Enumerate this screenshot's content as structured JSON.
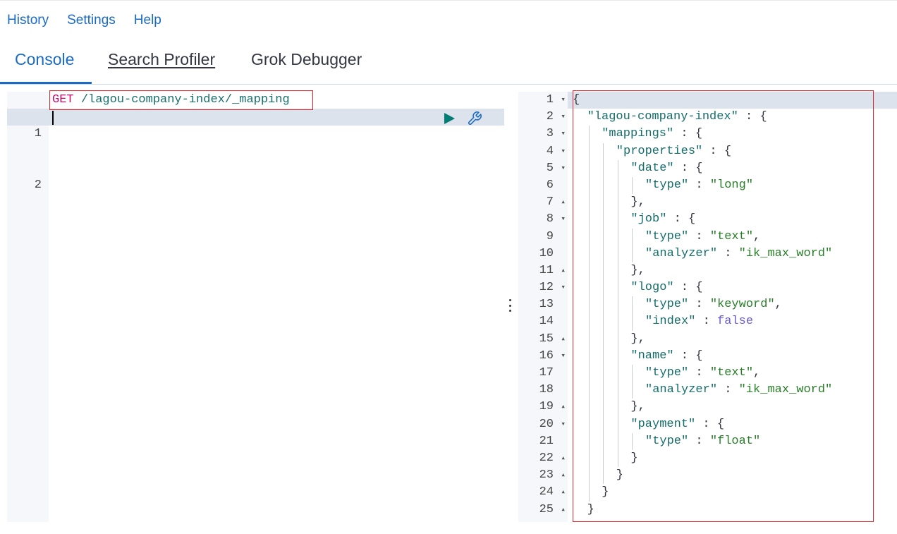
{
  "menu": {
    "history": "History",
    "settings": "Settings",
    "help": "Help"
  },
  "tabs": [
    {
      "label": "Console"
    },
    {
      "label": "Search Profiler"
    },
    {
      "label": "Grok Debugger"
    }
  ],
  "colors": {
    "accent": "#1b6bc4",
    "highlight_box": "#e3242b",
    "active_line": "#dde3ec",
    "play": "#017d73"
  },
  "request": {
    "line_numbers": [
      "1",
      "2"
    ],
    "method": "GET",
    "path": "/lagou-company-index/_mapping",
    "actions": {
      "run_icon": "play-icon",
      "settings_icon": "wrench-icon"
    }
  },
  "response": {
    "line_numbers": [
      "1",
      "2",
      "3",
      "4",
      "5",
      "6",
      "7",
      "8",
      "9",
      "10",
      "11",
      "12",
      "13",
      "14",
      "15",
      "16",
      "17",
      "18",
      "19",
      "20",
      "21",
      "22",
      "23",
      "24",
      "25"
    ],
    "fold_markers": [
      "▾",
      "▾",
      "▾",
      "▾",
      "▾",
      "",
      "▴",
      "▾",
      "",
      "",
      "▴",
      "▾",
      "",
      "",
      "▴",
      "▾",
      "",
      "",
      "▴",
      "▾",
      "",
      "▴",
      "▴",
      "▴",
      "▴"
    ],
    "lines": [
      {
        "indent": 0,
        "tokens": [
          {
            "t": "{",
            "c": "p"
          }
        ]
      },
      {
        "indent": 1,
        "tokens": [
          {
            "t": "\"lagou-company-index\"",
            "c": "k"
          },
          {
            "t": " : {",
            "c": "p"
          }
        ]
      },
      {
        "indent": 2,
        "tokens": [
          {
            "t": "\"mappings\"",
            "c": "k"
          },
          {
            "t": " : {",
            "c": "p"
          }
        ]
      },
      {
        "indent": 3,
        "tokens": [
          {
            "t": "\"properties\"",
            "c": "k"
          },
          {
            "t": " : {",
            "c": "p"
          }
        ]
      },
      {
        "indent": 4,
        "tokens": [
          {
            "t": "\"date\"",
            "c": "k"
          },
          {
            "t": " : {",
            "c": "p"
          }
        ]
      },
      {
        "indent": 5,
        "tokens": [
          {
            "t": "\"type\"",
            "c": "k"
          },
          {
            "t": " : ",
            "c": "p"
          },
          {
            "t": "\"long\"",
            "c": "s"
          }
        ]
      },
      {
        "indent": 4,
        "tokens": [
          {
            "t": "},",
            "c": "p"
          }
        ]
      },
      {
        "indent": 4,
        "tokens": [
          {
            "t": "\"job\"",
            "c": "k"
          },
          {
            "t": " : {",
            "c": "p"
          }
        ]
      },
      {
        "indent": 5,
        "tokens": [
          {
            "t": "\"type\"",
            "c": "k"
          },
          {
            "t": " : ",
            "c": "p"
          },
          {
            "t": "\"text\"",
            "c": "s"
          },
          {
            "t": ",",
            "c": "p"
          }
        ]
      },
      {
        "indent": 5,
        "tokens": [
          {
            "t": "\"analyzer\"",
            "c": "k"
          },
          {
            "t": " : ",
            "c": "p"
          },
          {
            "t": "\"ik_max_word\"",
            "c": "s"
          }
        ]
      },
      {
        "indent": 4,
        "tokens": [
          {
            "t": "},",
            "c": "p"
          }
        ]
      },
      {
        "indent": 4,
        "tokens": [
          {
            "t": "\"logo\"",
            "c": "k"
          },
          {
            "t": " : {",
            "c": "p"
          }
        ]
      },
      {
        "indent": 5,
        "tokens": [
          {
            "t": "\"type\"",
            "c": "k"
          },
          {
            "t": " : ",
            "c": "p"
          },
          {
            "t": "\"keyword\"",
            "c": "s"
          },
          {
            "t": ",",
            "c": "p"
          }
        ]
      },
      {
        "indent": 5,
        "tokens": [
          {
            "t": "\"index\"",
            "c": "k"
          },
          {
            "t": " : ",
            "c": "p"
          },
          {
            "t": "false",
            "c": "b"
          }
        ]
      },
      {
        "indent": 4,
        "tokens": [
          {
            "t": "},",
            "c": "p"
          }
        ]
      },
      {
        "indent": 4,
        "tokens": [
          {
            "t": "\"name\"",
            "c": "k"
          },
          {
            "t": " : {",
            "c": "p"
          }
        ]
      },
      {
        "indent": 5,
        "tokens": [
          {
            "t": "\"type\"",
            "c": "k"
          },
          {
            "t": " : ",
            "c": "p"
          },
          {
            "t": "\"text\"",
            "c": "s"
          },
          {
            "t": ",",
            "c": "p"
          }
        ]
      },
      {
        "indent": 5,
        "tokens": [
          {
            "t": "\"analyzer\"",
            "c": "k"
          },
          {
            "t": " : ",
            "c": "p"
          },
          {
            "t": "\"ik_max_word\"",
            "c": "s"
          }
        ]
      },
      {
        "indent": 4,
        "tokens": [
          {
            "t": "},",
            "c": "p"
          }
        ]
      },
      {
        "indent": 4,
        "tokens": [
          {
            "t": "\"payment\"",
            "c": "k"
          },
          {
            "t": " : {",
            "c": "p"
          }
        ]
      },
      {
        "indent": 5,
        "tokens": [
          {
            "t": "\"type\"",
            "c": "k"
          },
          {
            "t": " : ",
            "c": "p"
          },
          {
            "t": "\"float\"",
            "c": "s"
          }
        ]
      },
      {
        "indent": 4,
        "tokens": [
          {
            "t": "}",
            "c": "p"
          }
        ]
      },
      {
        "indent": 3,
        "tokens": [
          {
            "t": "}",
            "c": "p"
          }
        ]
      },
      {
        "indent": 2,
        "tokens": [
          {
            "t": "}",
            "c": "p"
          }
        ]
      },
      {
        "indent": 1,
        "tokens": [
          {
            "t": "}",
            "c": "p"
          }
        ]
      }
    ]
  }
}
